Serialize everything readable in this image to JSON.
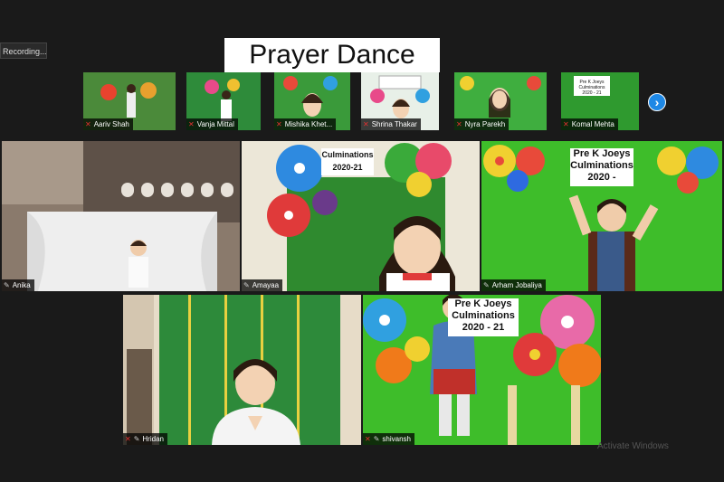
{
  "recording_label": "Recording...",
  "title_banner": "Prayer Dance",
  "next_page_icon": "chevron-right-icon",
  "gallery_strip": [
    {
      "name": "Aariv Shah",
      "muted": true
    },
    {
      "name": "Vanja Mittal",
      "muted": true
    },
    {
      "name": "Mishika  Khet...",
      "muted": true
    },
    {
      "name": "Shrina Thakar",
      "muted": true
    },
    {
      "name": "Nyra Parekh",
      "muted": true
    },
    {
      "name": "Komal Mehta",
      "muted": true
    }
  ],
  "main_tiles": [
    {
      "name": "Anika"
    },
    {
      "name": "Amayaa",
      "sign": "Culminations 2020-21"
    },
    {
      "name": "Arham Jobaliya",
      "sign": "Pre K Joeys Culminations 2020 -"
    },
    {
      "name": "Hridan"
    },
    {
      "name": "shivansh",
      "sign": "Pre K Joeys Culminations 2020 - 21"
    }
  ],
  "watermark": "Activate Windows",
  "colors": {
    "background": "#1a1a1a",
    "name_bar": "#000000",
    "mic_muted": "#e03030",
    "next_button": "#1e88e5"
  }
}
